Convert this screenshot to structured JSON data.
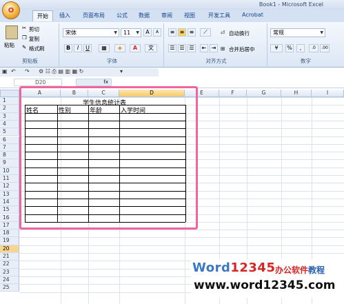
{
  "window": {
    "title": "Book1 - Microsoft Excel",
    "office_button": "O"
  },
  "tabs": [
    "开始",
    "插入",
    "页面布局",
    "公式",
    "数据",
    "审阅",
    "视图",
    "开发工具",
    "Acrobat"
  ],
  "ribbon": {
    "clipboard": {
      "paste": "粘贴",
      "cut": "剪切",
      "copy": "复制",
      "format_painter": "格式刷",
      "label": "剪贴板"
    },
    "font": {
      "name": "宋体",
      "size": "11",
      "grow": "A",
      "shrink": "A",
      "bold": "B",
      "italic": "I",
      "underline": "U",
      "label": "字体"
    },
    "alignment": {
      "wrap": "自动换行",
      "merge": "合并后居中",
      "label": "对齐方式"
    },
    "number": {
      "format": "常规",
      "percent": "%",
      "comma": ",",
      "label": "数字"
    }
  },
  "quick_access": {
    "items": "▾"
  },
  "formula_bar": {
    "name_box": "D20",
    "fx": "fx"
  },
  "sheet": {
    "columns": [
      "A",
      "B",
      "C",
      "D",
      "E",
      "F",
      "G",
      "H",
      "I"
    ],
    "rows": [
      "1",
      "2",
      "3",
      "4",
      "5",
      "6",
      "7",
      "8",
      "9",
      "10",
      "11",
      "12",
      "13",
      "14",
      "15",
      "16",
      "17",
      "18",
      "19",
      "20",
      "21",
      "22",
      "23",
      "24",
      "25"
    ],
    "table_title": "学生信息统计表",
    "headers": [
      "姓名",
      "性别",
      "年龄",
      "入学时间"
    ]
  },
  "watermark": {
    "brand_w": "Word",
    "brand_num": "12345",
    "brand_cn_1": "办公软件",
    "brand_cn_2": "教程",
    "url": "www.word12345.com"
  },
  "colors": {
    "highlight": "#f0659b",
    "ribbon": "#dce7f5",
    "selected_header": "#f7c867"
  }
}
